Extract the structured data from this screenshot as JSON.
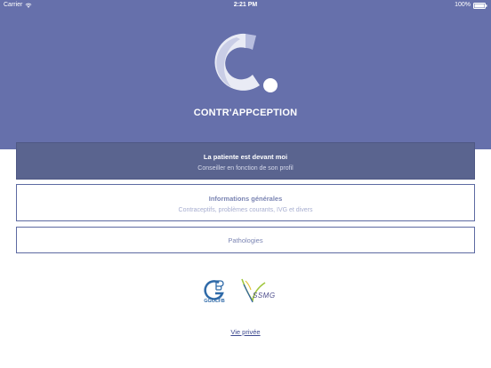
{
  "status_bar": {
    "carrier": "Carrier",
    "time": "2:21 PM",
    "battery": "100%"
  },
  "app": {
    "title": "CONTR'APPCEPTION"
  },
  "cards": [
    {
      "title": "La patiente est devant moi",
      "subtitle": "Conseiller en fonction de son profil"
    },
    {
      "title": "Informations générales",
      "subtitle": "Contraceptifs, problèmes courants, IVG et divers"
    },
    {
      "title": "Pathologies"
    }
  ],
  "partners": {
    "ggolfb": "GGOLFB",
    "ssmg": "SSMG"
  },
  "footer": {
    "privacy_link": "Vie privée"
  },
  "colors": {
    "header_bg": "#6670ab",
    "primary_card": "#5a648f",
    "card_border": "#5d6aa2",
    "link": "#3d4a90"
  },
  "icons": {
    "status": [
      "wifi-icon",
      "battery-icon"
    ],
    "logo": "app-logo-icon"
  }
}
